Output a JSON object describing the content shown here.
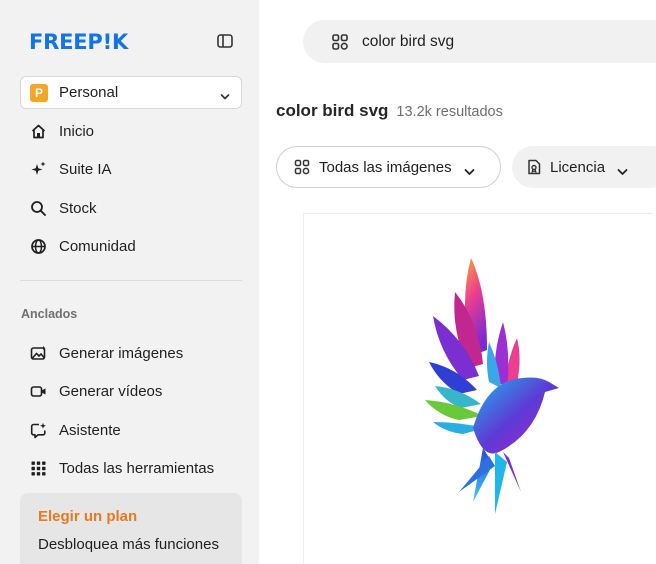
{
  "brand": {
    "logo_text": "FREEP!K"
  },
  "workspace": {
    "badge": "P",
    "label": "Personal",
    "badge_color": "#f5a623"
  },
  "nav": [
    {
      "label": "Inicio",
      "icon": "home-icon"
    },
    {
      "label": "Suite IA",
      "icon": "sparkle-icon"
    },
    {
      "label": "Stock",
      "icon": "search-icon"
    },
    {
      "label": "Comunidad",
      "icon": "globe-icon"
    }
  ],
  "pinned": {
    "section_label": "Anclados",
    "items": [
      {
        "label": "Generar imágenes",
        "icon": "image-generate-icon"
      },
      {
        "label": "Generar vídeos",
        "icon": "video-generate-icon"
      },
      {
        "label": "Asistente",
        "icon": "assistant-icon"
      },
      {
        "label": "Todas las herramientas",
        "icon": "grid-dots-icon"
      }
    ]
  },
  "plan": {
    "title": "Elegir un plan",
    "text": "Desbloquea más funciones",
    "title_color": "#e8791f"
  },
  "search": {
    "query": "color bird svg"
  },
  "results": {
    "title": "color bird svg",
    "count": "13.2k resultados"
  },
  "filters": {
    "images_label": "Todas las imágenes",
    "license_label": "Licencia"
  },
  "colors": {
    "brand": "#1273eb",
    "sidebar_bg": "#f2f2f2"
  }
}
